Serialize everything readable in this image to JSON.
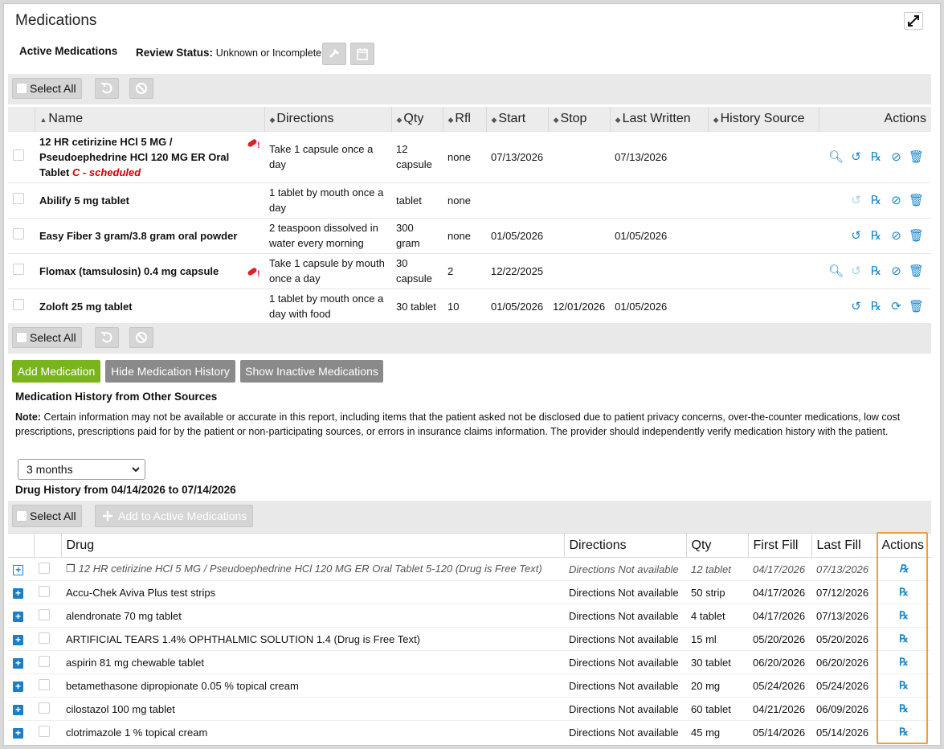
{
  "page": {
    "title": "Medications",
    "active_tab": "Active Medications",
    "review_status_label": "Review Status:",
    "review_status_value": "Unknown or Incomplete"
  },
  "toolbar": {
    "select_all": "Select All"
  },
  "med_table": {
    "headers": [
      "Name",
      "Directions",
      "Qty",
      "Rfl",
      "Start",
      "Stop",
      "Last Written",
      "History Source",
      "Actions"
    ],
    "rows": [
      {
        "name": "12 HR cetirizine HCl 5 MG / Pseudoephedrine HCl 120 MG ER Oral Tablet",
        "schedule": "C - scheduled",
        "directions": "Take 1 capsule once a day",
        "qty": "12 capsule",
        "rfl": "none",
        "start": "07/13/2026",
        "stop": "",
        "last_written": "07/13/2026",
        "history_source": ""
      },
      {
        "name": "Abilify 5 mg tablet",
        "schedule": "",
        "directions": "1 tablet by mouth once a day",
        "qty": "tablet",
        "rfl": "none",
        "start": "",
        "stop": "",
        "last_written": "",
        "history_source": ""
      },
      {
        "name": "Easy Fiber 3 gram/3.8 gram oral powder",
        "schedule": "",
        "directions": "2 teaspoon dissolved in water every morning",
        "qty": "300 gram",
        "rfl": "none",
        "start": "01/05/2026",
        "stop": "",
        "last_written": "01/05/2026",
        "history_source": ""
      },
      {
        "name": "Flomax (tamsulosin) 0.4 mg capsule",
        "schedule": "",
        "directions": "Take 1 capsule by mouth once a day",
        "qty": "30 capsule",
        "rfl": "2",
        "start": "12/22/2025",
        "stop": "",
        "last_written": "",
        "history_source": ""
      },
      {
        "name": "Zoloft 25 mg tablet",
        "schedule": "",
        "directions": "1 tablet by mouth once a day with food",
        "qty": "30 tablet",
        "rfl": "10",
        "start": "01/05/2026",
        "stop": "12/01/2026",
        "last_written": "01/05/2026",
        "history_source": ""
      }
    ]
  },
  "buttons": {
    "add_medication": "Add Medication",
    "hide_history": "Hide Medication History",
    "show_inactive": "Show Inactive Medications",
    "add_to_active": "Add to Active Medications"
  },
  "history": {
    "heading": "Medication History from Other Sources",
    "note_label": "Note:",
    "note_text": "Certain information may not be available or accurate in this report, including items that the patient asked not be disclosed due to patient privacy concerns, over-the-counter medications, low cost prescriptions, prescriptions paid for by the patient or non-participating sources, or errors in insurance claims information. The provider should independently verify medication history with the patient.",
    "period": "3 months",
    "drug_history_title": "Drug History from 04/14/2026 to 07/14/2026",
    "headers": [
      "Drug",
      "Directions",
      "Qty",
      "First Fill",
      "Last Fill",
      "Actions"
    ],
    "rows": [
      {
        "drug": "12 HR cetirizine HCl 5 MG / Pseudoephedrine HCl 120 MG ER Oral Tablet 5-120 (Drug is Free Text)",
        "directions": "Directions Not available",
        "qty": "12 tablet",
        "first_fill": "04/17/2026",
        "last_fill": "07/13/2026",
        "free_text": true
      },
      {
        "drug": "Accu-Chek Aviva Plus test strips",
        "directions": "Directions Not available",
        "qty": "50 strip",
        "first_fill": "04/17/2026",
        "last_fill": "07/12/2026",
        "free_text": false
      },
      {
        "drug": "alendronate 70 mg tablet",
        "directions": "Directions Not available",
        "qty": "4 tablet",
        "first_fill": "04/17/2026",
        "last_fill": "07/13/2026",
        "free_text": false
      },
      {
        "drug": "ARTIFICIAL TEARS 1.4% OPHTHALMIC SOLUTION 1.4 (Drug is Free Text)",
        "directions": "Directions Not available",
        "qty": "15 ml",
        "first_fill": "05/20/2026",
        "last_fill": "05/20/2026",
        "free_text": false
      },
      {
        "drug": "aspirin 81 mg chewable tablet",
        "directions": "Directions Not available",
        "qty": "30 tablet",
        "first_fill": "06/20/2026",
        "last_fill": "06/20/2026",
        "free_text": false
      },
      {
        "drug": "betamethasone dipropionate 0.05 % topical cream",
        "directions": "Directions Not available",
        "qty": "20 mg",
        "first_fill": "05/24/2026",
        "last_fill": "05/24/2026",
        "free_text": false
      },
      {
        "drug": "cilostazol 100 mg tablet",
        "directions": "Directions Not available",
        "qty": "60 tablet",
        "first_fill": "04/21/2026",
        "last_fill": "06/09/2026",
        "free_text": false
      },
      {
        "drug": "clotrimazole 1 % topical cream",
        "directions": "Directions Not available",
        "qty": "45 mg",
        "first_fill": "05/14/2026",
        "last_fill": "05/14/2026",
        "free_text": false
      }
    ]
  },
  "colors": {
    "accent_blue": "#1a86c8",
    "add_green": "#7ab41d",
    "highlight_orange": "#f39c3c",
    "schedule_red": "#cc0000"
  }
}
